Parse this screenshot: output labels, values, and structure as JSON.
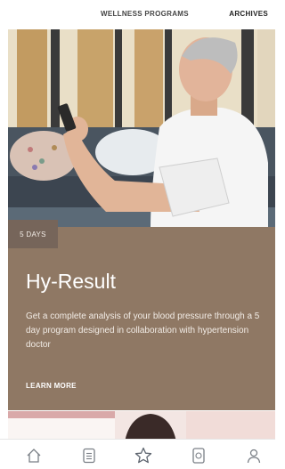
{
  "tabs": {
    "programs_label": "WELLNESS PROGRAMS",
    "archives_label": "ARCHIVES"
  },
  "card": {
    "days_tag": "5 DAYS",
    "title": "Hy-Result",
    "description": "Get a complete analysis of your blood pressure through a 5 day program designed in collaboration with hypertension doctor",
    "cta_label": "LEARN MORE"
  },
  "colors": {
    "card_background": "#8f7864",
    "tag_background": "#76655a",
    "nav_icon": "#7a7f86"
  },
  "bottom_nav": {
    "items": [
      "home-icon",
      "list-icon",
      "star-icon",
      "watch-icon",
      "profile-icon"
    ]
  }
}
